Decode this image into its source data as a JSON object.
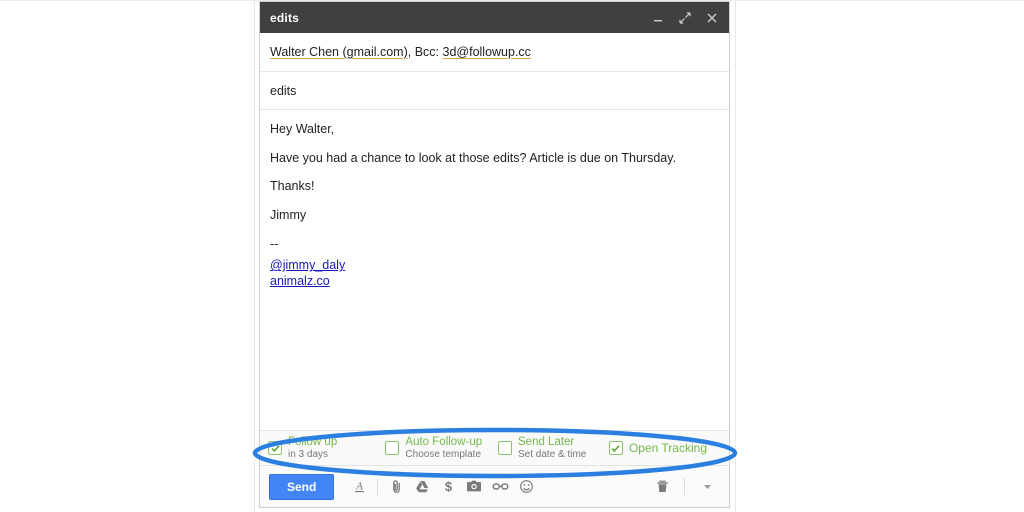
{
  "window": {
    "title": "edits",
    "controls": [
      {
        "name": "minimize",
        "icon": "minimize-icon"
      },
      {
        "name": "expand",
        "icon": "expand-icon"
      },
      {
        "name": "close",
        "icon": "close-icon"
      }
    ]
  },
  "compose": {
    "recipients": {
      "to_name": "Walter Chen (gmail.com)",
      "separator": ", Bcc: ",
      "bcc": "3d@followup.cc"
    },
    "subject": "edits",
    "body": {
      "greeting": "Hey Walter,",
      "line1": "Have you had a chance to look at those edits? Article is due on Thursday.",
      "line2": "Thanks!",
      "line3": "Jimmy",
      "divider": "--",
      "signature_handle": "@jimmy_daly",
      "signature_site": "animalz.co"
    }
  },
  "features": [
    {
      "label": "Follow up",
      "sub": "in 3 days",
      "checked": true,
      "icon": "checkbox-checked-icon"
    },
    {
      "label": "Auto Follow-up",
      "sub": "Choose template",
      "checked": false,
      "icon": "checkbox-unchecked-icon"
    },
    {
      "label": "Send Later",
      "sub": "Set date & time",
      "checked": false,
      "icon": "checkbox-unchecked-icon"
    },
    {
      "label": "Open Tracking",
      "sub": "",
      "checked": true,
      "icon": "checkbox-checked-icon"
    }
  ],
  "toolbar": {
    "send_label": "Send",
    "icons": [
      "format-text-icon",
      "attach-file-icon",
      "google-drive-icon",
      "insert-money-icon",
      "insert-photo-icon",
      "insert-link-icon",
      "insert-emoji-icon",
      "delete-draft-icon",
      "more-options-icon"
    ]
  },
  "colors": {
    "accent_blue": "#4285f4",
    "annotation_blue": "#2a7fe0",
    "feature_green": "#74b84a",
    "titlebar": "#404040",
    "spellcheck_underline": "#d9a441",
    "link_blue": "#1919c4"
  }
}
